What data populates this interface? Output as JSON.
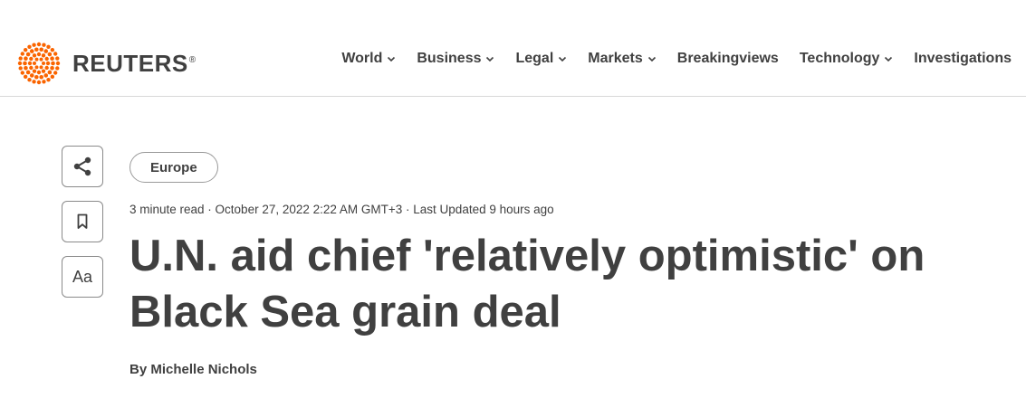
{
  "brand": {
    "name": "REUTERS",
    "registered": "®",
    "accent_color": "#fa6400"
  },
  "nav": {
    "items": [
      {
        "label": "World",
        "dropdown": true
      },
      {
        "label": "Business",
        "dropdown": true
      },
      {
        "label": "Legal",
        "dropdown": true
      },
      {
        "label": "Markets",
        "dropdown": true
      },
      {
        "label": "Breakingviews",
        "dropdown": false
      },
      {
        "label": "Technology",
        "dropdown": true
      },
      {
        "label": "Investigations",
        "dropdown": false
      }
    ]
  },
  "sidebar": {
    "share_icon": "share-icon",
    "bookmark_icon": "bookmark-icon",
    "text_size_label": "Aa"
  },
  "article": {
    "category": "Europe",
    "meta": "3 minute read · October 27, 2022 2:22 AM GMT+3 · Last Updated 9 hours ago",
    "headline": "U.N. aid chief 'relatively optimistic' on Black Sea grain deal",
    "byline_prefix": "By ",
    "author": "Michelle Nichols"
  }
}
